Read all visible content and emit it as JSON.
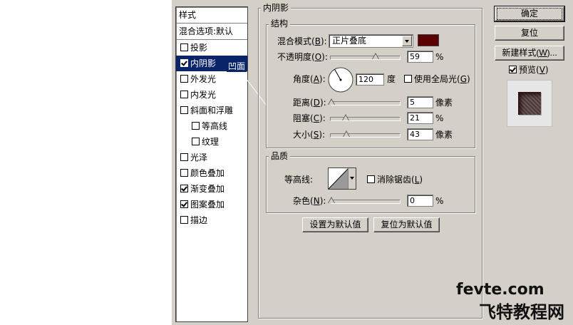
{
  "styles_panel": {
    "header": "样式",
    "blend_options": "混合选项:默认",
    "items": [
      {
        "label": "投影",
        "checked": false,
        "sub": false,
        "selected": false
      },
      {
        "label": "内阴影",
        "checked": true,
        "sub": false,
        "selected": true
      },
      {
        "label": "外发光",
        "checked": false,
        "sub": false,
        "selected": false
      },
      {
        "label": "内发光",
        "checked": false,
        "sub": false,
        "selected": false
      },
      {
        "label": "斜面和浮雕",
        "checked": false,
        "sub": false,
        "selected": false
      },
      {
        "label": "等高线",
        "checked": false,
        "sub": true,
        "selected": false
      },
      {
        "label": "纹理",
        "checked": false,
        "sub": true,
        "selected": false
      },
      {
        "label": "光泽",
        "checked": false,
        "sub": false,
        "selected": false
      },
      {
        "label": "颜色叠加",
        "checked": false,
        "sub": false,
        "selected": false
      },
      {
        "label": "渐变叠加",
        "checked": true,
        "sub": false,
        "selected": false
      },
      {
        "label": "图案叠加",
        "checked": true,
        "sub": false,
        "selected": false
      },
      {
        "label": "描边",
        "checked": false,
        "sub": false,
        "selected": false
      }
    ],
    "tooltip_text": "凹面"
  },
  "inner_shadow": {
    "title": "内阴影",
    "structure": {
      "title": "结构",
      "blend_mode_label": "混合模式",
      "blend_mode_key": "B",
      "blend_mode_value": "正片叠底",
      "color": "#5a0000",
      "opacity_label": "不透明度",
      "opacity_key": "O",
      "opacity_value": "59",
      "opacity_unit": "%",
      "angle_label": "角度",
      "angle_key": "A",
      "angle_value": "120",
      "angle_unit": "度",
      "global_light_label": "使用全局光",
      "global_light_key": "G",
      "global_light_checked": false,
      "distance_label": "距离",
      "distance_key": "D",
      "distance_value": "5",
      "distance_unit": "像素",
      "choke_label": "阻塞",
      "choke_key": "C",
      "choke_value": "21",
      "choke_unit": "%",
      "size_label": "大小",
      "size_key": "S",
      "size_value": "43",
      "size_unit": "像素"
    },
    "quality": {
      "title": "品质",
      "contour_label": "等高线:",
      "antialias_label": "消除锯齿",
      "antialias_key": "L",
      "antialias_checked": false,
      "noise_label": "杂色",
      "noise_key": "N",
      "noise_value": "0",
      "noise_unit": "%"
    },
    "set_default_label": "设置为默认值",
    "reset_default_label": "复位为默认值"
  },
  "right_buttons": {
    "ok_label": "确定",
    "reset_label": "复位",
    "new_style_label": "新建样式(",
    "new_style_key": "W",
    "new_style_suffix": ")...",
    "preview_label": "预览(",
    "preview_key": "V",
    "preview_suffix": ")",
    "preview_checked": true
  },
  "watermark": {
    "line1": "fevte.com",
    "line2": "飞特教程网"
  }
}
